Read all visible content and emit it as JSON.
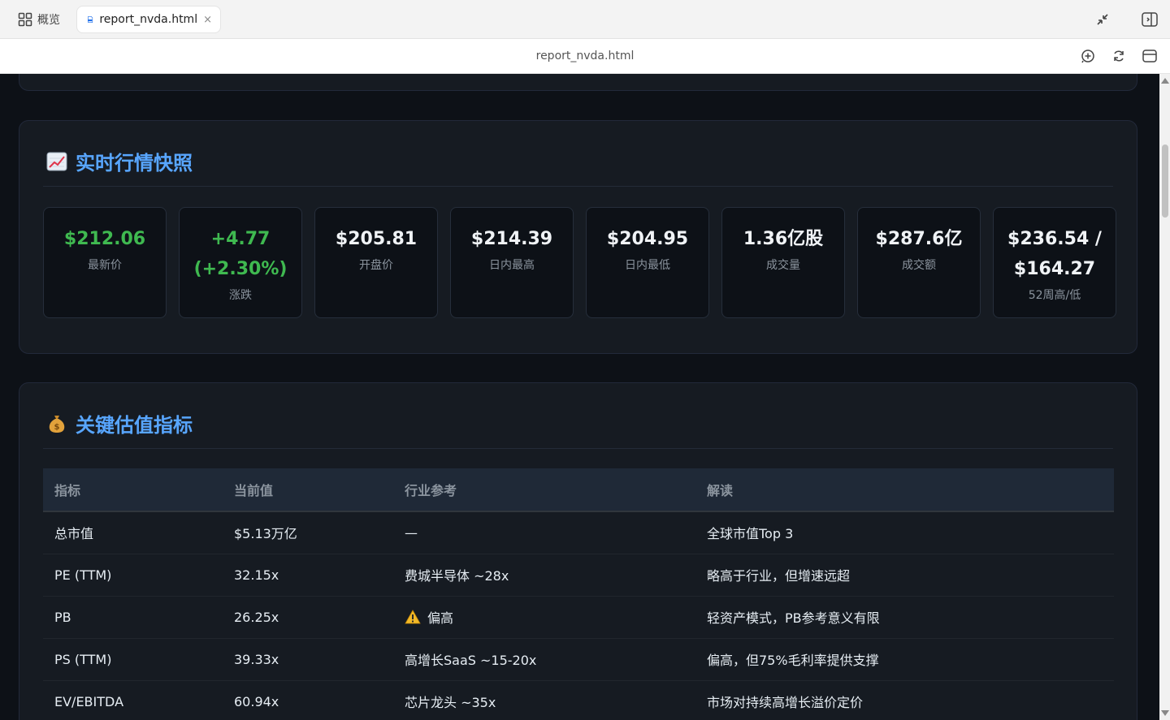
{
  "browser": {
    "overview_label": "概览",
    "tab_title": "report_nvda.html",
    "tab_close": "×",
    "address": "report_nvda.html"
  },
  "snapshot": {
    "title": "实时行情快照",
    "icon": "chart-increasing-emoji",
    "stats": [
      {
        "value": "$212.06",
        "label": "最新价",
        "color": "#3fb950"
      },
      {
        "value": "+4.77 (+2.30%)",
        "label": "涨跌",
        "color": "#3fb950"
      },
      {
        "value": "$205.81",
        "label": "开盘价",
        "color": "#f0f3f6"
      },
      {
        "value": "$214.39",
        "label": "日内最高",
        "color": "#f0f3f6"
      },
      {
        "value": "$204.95",
        "label": "日内最低",
        "color": "#f0f3f6"
      },
      {
        "value": "1.36亿股",
        "label": "成交量",
        "color": "#f0f3f6"
      },
      {
        "value": "$287.6亿",
        "label": "成交额",
        "color": "#f0f3f6"
      },
      {
        "value": "$236.54 / $164.27",
        "label": "52周高/低",
        "color": "#f0f3f6"
      }
    ]
  },
  "valuation": {
    "title": "关键估值指标",
    "icon": "money-bag-emoji",
    "headers": [
      "指标",
      "当前值",
      "行业参考",
      "解读"
    ],
    "rows": [
      [
        "总市值",
        "$5.13万亿",
        "—",
        "全球市值Top 3"
      ],
      [
        "PE (TTM)",
        "32.15x",
        "费城半导体 ~28x",
        "略高于行业，但增速远超"
      ],
      [
        "PB",
        "26.25x",
        "偏高",
        "轻资产模式，PB参考意义有限"
      ],
      [
        "PS (TTM)",
        "39.33x",
        "高增长SaaS ~15-20x",
        "偏高，但75%毛利率提供支撑"
      ],
      [
        "EV/EBITDA",
        "60.94x",
        "芯片龙头 ~35x",
        "市场对持续高增长溢价定价"
      ]
    ],
    "warning_row": 2,
    "warning_icon": "warning-icon"
  }
}
